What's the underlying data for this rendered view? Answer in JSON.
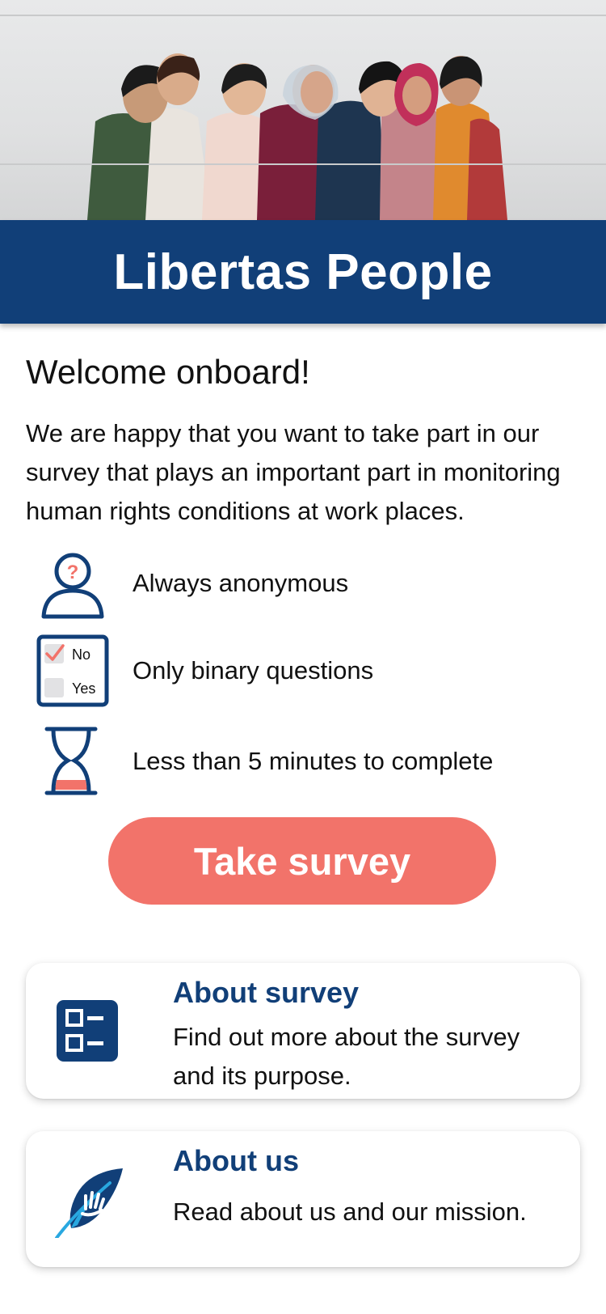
{
  "colors": {
    "brand": "#113f78",
    "accent": "#f2736a",
    "text": "#111111"
  },
  "hero": {
    "image": "group-photo"
  },
  "header": {
    "title": "Libertas People"
  },
  "welcome": {
    "heading": "Welcome onboard!",
    "intro": "We are happy that you want to take part in our survey that plays an important part in monitoring human rights conditions at work places."
  },
  "features": [
    {
      "icon": "anonymous-person-icon",
      "label": "Always anonymous"
    },
    {
      "icon": "checkbox-icon",
      "label": "Only binary questions",
      "icon_options": [
        "No",
        "Yes"
      ]
    },
    {
      "icon": "hourglass-icon",
      "label": "Less than 5 minutes to complete"
    }
  ],
  "cta": {
    "label": "Take survey"
  },
  "cards": [
    {
      "icon": "list-icon",
      "title": "About survey",
      "description": "Find out more about the survey and its purpose."
    },
    {
      "icon": "feather-hand-icon",
      "title": "About us",
      "description": "Read about us and our mission."
    }
  ]
}
